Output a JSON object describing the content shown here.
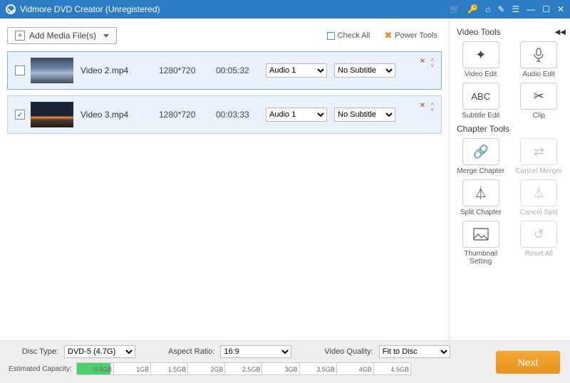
{
  "titlebar": {
    "title": "Vidmore DVD Creator (Unregistered)"
  },
  "toolbar": {
    "add_label": "Add Media File(s)",
    "check_all": "Check All",
    "power_tools": "Power Tools"
  },
  "items": [
    {
      "name": "Video 2.mp4",
      "resolution": "1280*720",
      "duration": "00:05:32",
      "audio": "Audio 1",
      "subtitle": "No Subtitle",
      "checked": false
    },
    {
      "name": "Video 3.mp4",
      "resolution": "1280*720",
      "duration": "00:03:33",
      "audio": "Audio 1",
      "subtitle": "No Subtitle",
      "checked": true
    }
  ],
  "sidebar": {
    "video_title": "Video Tools",
    "chapter_title": "Chapter Tools",
    "video_tools": [
      {
        "label": "Video Edit",
        "icon": "✦"
      },
      {
        "label": "Audio Edit",
        "icon": "mic"
      },
      {
        "label": "Subtitle Edit",
        "icon": "ABC"
      },
      {
        "label": "Clip",
        "icon": "✂"
      }
    ],
    "chapter_tools": [
      {
        "label": "Merge Chapter",
        "icon": "🔗",
        "disabled": false
      },
      {
        "label": "Cancel Merger",
        "icon": "⇄",
        "disabled": true
      },
      {
        "label": "Split Chapter",
        "icon": "⏃",
        "disabled": false
      },
      {
        "label": "Cancel Split",
        "icon": "⏃",
        "disabled": true
      },
      {
        "label": "Thumbnail Setting",
        "icon": "img",
        "disabled": false
      },
      {
        "label": "Reset All",
        "icon": "↺",
        "disabled": true
      }
    ]
  },
  "footer": {
    "disc_type_label": "Disc Type:",
    "disc_type_value": "DVD-5 (4.7G)",
    "aspect_label": "Aspect Ratio:",
    "aspect_value": "16:9",
    "quality_label": "Video Quality:",
    "quality_value": "Fit to Disc",
    "capacity_label": "Estimated Capacity:",
    "capacity_pct": 10,
    "ticks": [
      "0.5GB",
      "1GB",
      "1.5GB",
      "2GB",
      "2.5GB",
      "3GB",
      "3.5GB",
      "4GB",
      "4.5GB"
    ],
    "next": "Next"
  }
}
